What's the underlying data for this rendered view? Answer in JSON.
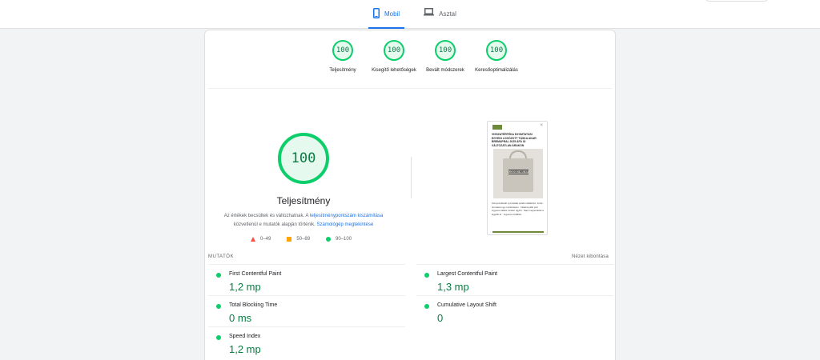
{
  "tabs": [
    {
      "label": "Mobil",
      "icon": "smartphone-icon",
      "active": true
    },
    {
      "label": "Asztal",
      "icon": "laptop-icon",
      "active": false
    }
  ],
  "summary_gauges": [
    {
      "score": "100",
      "label": "Teljesítmény"
    },
    {
      "score": "100",
      "label": "Kisegítő lehetőségek"
    },
    {
      "score": "100",
      "label": "Bevált módszerek"
    },
    {
      "score": "100",
      "label": "Keresőoptimalizálás"
    }
  ],
  "performance": {
    "score": "100",
    "title": "Teljesítmény",
    "note_prefix": "Az értékek becsültek és változhatnak. A",
    "note_link1": "teljesítménypontszám kiszámítása",
    "note_middle": "közvetlenül e mutatók alapján történik.",
    "note_link2": "Számológép megtekintése"
  },
  "legend": [
    {
      "range": "0–49",
      "color": "#ff4e42"
    },
    {
      "range": "50–89",
      "color": "#ffa400"
    },
    {
      "range": "90–100",
      "color": "#0cce6b"
    }
  ],
  "screenshot": {
    "headline": "VISSZATÉRTÉKA NYOMTATÁSI EGYEDI LOGÓZOTT TÁSKA AKAR BREMAPRAL 2025 ÁFÁ ÚI VÁLTOZATLAN ÁRAKON",
    "bag_logo": "LOGÓD HELYE",
    "body_text": "Környezetbarát nyomtatási pultők szálláshoz, tiszta termékek egy munkanapon · hatékonyabb pult ingyenes lakást minden ügyfél · Napi megrendelés a legjobb ár · Ingyenes szállítás"
  },
  "metrics_section": {
    "heading": "MUTATÓK",
    "expand_label": "Nézet kibontása"
  },
  "metrics": [
    {
      "name": "First Contentful Paint",
      "value": "1,2 mp"
    },
    {
      "name": "Largest Contentful Paint",
      "value": "1,3 mp"
    },
    {
      "name": "Total Blocking Time",
      "value": "0 ms"
    },
    {
      "name": "Cumulative Layout Shift",
      "value": "0"
    },
    {
      "name": "Speed Index",
      "value": "1,2 mp"
    }
  ],
  "colors": {
    "pass": "#0cce6b",
    "pass_text": "#0a7c42",
    "link": "#1a73e8"
  }
}
